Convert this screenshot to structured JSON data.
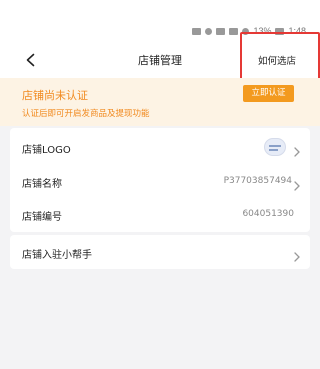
{
  "status_bar": {
    "battery_text": "13%",
    "time": "1:48"
  },
  "nav": {
    "title": "店铺管理",
    "help_link": "如何选店",
    "back_icon": "chevron-left-icon"
  },
  "notice": {
    "title": "店铺尚未认证",
    "description": "认证后即可开启发商品及提现功能",
    "action_label": "立即认证",
    "accent_color": "#f18a1f"
  },
  "info_rows": [
    {
      "label": "店铺LOGO",
      "value": "",
      "chevron": true
    },
    {
      "label": "店铺名称",
      "value": "P37703857494",
      "chevron": true
    },
    {
      "label": "店铺编号",
      "value": "604051390",
      "chevron": false
    }
  ],
  "helper": {
    "label": "店铺入驻小帮手"
  },
  "colors": {
    "highlight": "#e53935",
    "button": "#f39a1f",
    "banner_bg": "#fdf3e4"
  }
}
